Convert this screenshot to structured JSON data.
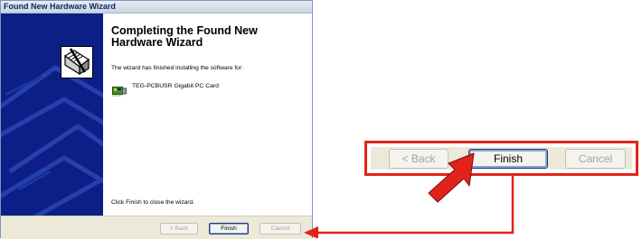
{
  "window": {
    "title": "Found New Hardware Wizard",
    "heading": "Completing the Found New Hardware Wizard",
    "description": "The wizard has finished installing the software for:",
    "device_name": "TEG-PCBUSR Gigabit PC Card",
    "close_hint": "Click Finish to close the wizard.",
    "buttons": {
      "back": "< Back",
      "finish": "Finish",
      "cancel": "Cancel"
    }
  },
  "callout": {
    "buttons": {
      "back": "< Back",
      "finish": "Finish",
      "cancel": "Cancel"
    }
  },
  "colors": {
    "highlight": "#e2231a",
    "side_panel": "#0b1f86",
    "dialog_face": "#ece9d8"
  },
  "icons": [
    "hardware-wizard-icon",
    "network-card-icon",
    "pointer-arrow-icon"
  ]
}
